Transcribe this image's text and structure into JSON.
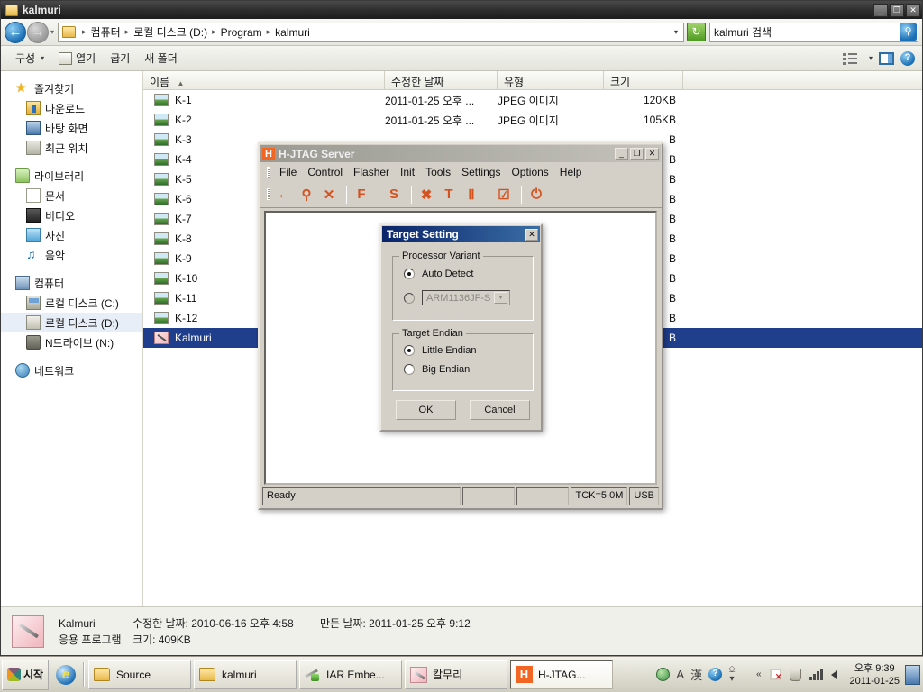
{
  "explorer": {
    "title": "kalmuri",
    "window_buttons": {
      "minimize": "_",
      "restore": "❐",
      "close": "✕"
    },
    "nav": {
      "back_icon": "←",
      "forward_icon": "→",
      "history_caret": "▾",
      "breadcrumbs": [
        "컴퓨터",
        "로컬 디스크 (D:)",
        "Program",
        "kalmuri"
      ],
      "crumb_separator": "▸",
      "address_caret": "▾",
      "refresh_icon": "↻",
      "search_value": "kalmuri 검색",
      "search_placeholder": "kalmuri 검색",
      "search_icon": "⚲"
    },
    "toolbar": {
      "organize": "구성",
      "organize_caret": "▾",
      "open": "열기",
      "burn": "굽기",
      "new_folder": "새 폴더",
      "views_caret": "▾",
      "help": "?"
    },
    "sidebar": {
      "groups": [
        {
          "header": {
            "label": "즐겨찾기",
            "icon": "star-icon"
          },
          "items": [
            {
              "label": "다운로드",
              "icon": "downloads-icon"
            },
            {
              "label": "바탕 화면",
              "icon": "desktop-icon"
            },
            {
              "label": "최근 위치",
              "icon": "recent-places-icon"
            }
          ]
        },
        {
          "header": {
            "label": "라이브러리",
            "icon": "library-icon"
          },
          "items": [
            {
              "label": "문서",
              "icon": "documents-icon"
            },
            {
              "label": "비디오",
              "icon": "videos-icon"
            },
            {
              "label": "사진",
              "icon": "pictures-icon"
            },
            {
              "label": "음악",
              "icon": "music-icon"
            }
          ]
        },
        {
          "header": {
            "label": "컴퓨터",
            "icon": "computer-icon"
          },
          "items": [
            {
              "label": "로컬 디스크 (C:)",
              "icon": "local-disk-c-icon"
            },
            {
              "label": "로컬 디스크 (D:)",
              "icon": "local-disk-d-icon",
              "selected": true
            },
            {
              "label": "N드라이브 (N:)",
              "icon": "network-drive-icon"
            }
          ]
        },
        {
          "header": {
            "label": "네트워크",
            "icon": "network-icon"
          },
          "items": []
        }
      ]
    },
    "filelist": {
      "columns": [
        "이름",
        "수정한 날짜",
        "유형",
        "크기"
      ],
      "sort_indicator": "▲",
      "rows": [
        {
          "name": "K-1",
          "date": "2011-01-25 오후 ...",
          "type": "JPEG 이미지",
          "size": "120KB"
        },
        {
          "name": "K-2",
          "date": "2011-01-25 오후 ...",
          "type": "JPEG 이미지",
          "size": "105KB"
        },
        {
          "name": "K-3",
          "date": "",
          "type": "",
          "size": "B"
        },
        {
          "name": "K-4",
          "date": "",
          "type": "",
          "size": "B"
        },
        {
          "name": "K-5",
          "date": "",
          "type": "",
          "size": "B"
        },
        {
          "name": "K-6",
          "date": "",
          "type": "",
          "size": "B"
        },
        {
          "name": "K-7",
          "date": "",
          "type": "",
          "size": "B"
        },
        {
          "name": "K-8",
          "date": "",
          "type": "",
          "size": "B"
        },
        {
          "name": "K-9",
          "date": "",
          "type": "",
          "size": "B"
        },
        {
          "name": "K-10",
          "date": "",
          "type": "",
          "size": "B"
        },
        {
          "name": "K-11",
          "date": "",
          "type": "",
          "size": "B"
        },
        {
          "name": "K-12",
          "date": "",
          "type": "",
          "size": "B"
        },
        {
          "name": "Kalmuri",
          "date": "",
          "type": "",
          "size": "B",
          "selected": true,
          "icon": "exe-icon"
        }
      ]
    },
    "details": {
      "name": "Kalmuri",
      "kind": "응용 프로그램",
      "modified_label": "수정한 날짜: 2010-06-16 오후 4:58",
      "size_label": "크기: 409KB",
      "created_label": "만든 날짜: 2011-01-25 오후 9:12"
    }
  },
  "hjtag": {
    "title": "H-JTAG Server",
    "icon_letter": "H",
    "window_buttons": {
      "minimize": "_",
      "maximize": "❐",
      "close": "✕"
    },
    "menus": [
      "File",
      "Control",
      "Flasher",
      "Init",
      "Tools",
      "Settings",
      "Options",
      "Help"
    ],
    "toolbar_icons": [
      {
        "name": "detect-target-icon",
        "glyph": "←"
      },
      {
        "name": "search-icon",
        "glyph": "⚲"
      },
      {
        "name": "close-target-icon",
        "glyph": "✕"
      },
      {
        "name": "flasher-icon",
        "glyph": "F"
      },
      {
        "name": "settings-icon",
        "glyph": "S"
      },
      {
        "name": "jtag-config-icon",
        "glyph": "✖"
      },
      {
        "name": "tap-config-icon",
        "glyph": "T"
      },
      {
        "name": "pillar-config-icon",
        "glyph": "Ⅱ"
      },
      {
        "name": "checklist-icon",
        "glyph": "☑"
      },
      {
        "name": "power-icon",
        "glyph": "⏻"
      }
    ],
    "status": {
      "message": "Ready",
      "cell1": "",
      "cell2": "",
      "tck": "TCK=5,0M",
      "iface": "USB"
    }
  },
  "dialog": {
    "title": "Target Setting",
    "close_button": "✕",
    "processor_variant": {
      "legend": "Processor Variant",
      "auto_detect_label": "Auto  Detect",
      "auto_detect_selected": true,
      "manual_selected": false,
      "variant_value": "ARM1136JF-S",
      "dropdown_arrow": "▼",
      "disabled": true
    },
    "target_endian": {
      "legend": "Target Endian",
      "options": [
        {
          "label": "Little  Endian",
          "selected": true
        },
        {
          "label": "Big   Endian",
          "selected": false
        }
      ]
    },
    "ok_button": "OK",
    "cancel_button": "Cancel"
  },
  "taskbar": {
    "start_label": "시작",
    "quicklaunch": [
      {
        "name": "internet-explorer-icon",
        "glyph": "e"
      }
    ],
    "buttons": [
      {
        "label": "Source",
        "icon": "folder-icon",
        "active": false
      },
      {
        "label": "kalmuri",
        "icon": "folder-icon",
        "active": false
      },
      {
        "label": "IAR Embe...",
        "icon": "iar-icon",
        "active": false
      },
      {
        "label": "칼무리",
        "icon": "kalmuri-icon",
        "active": false
      },
      {
        "label": "H-JTAG...",
        "icon": "hjtag-icon",
        "active": true
      }
    ],
    "ime": {
      "globe": "●",
      "latin": "A",
      "hanja": "漢",
      "help": "?",
      "keyboard": "⌨"
    },
    "tray": {
      "expand": "«",
      "icons": [
        "network-disconnected-icon",
        "security-shield-icon",
        "signal-bars-icon",
        "volume-icon"
      ]
    },
    "clock": {
      "time": "오후 9:39",
      "date": "2011-01-25"
    },
    "show_desktop": "show-desktop-button"
  },
  "colors": {
    "desktop": "#000000",
    "selection_blue": "#1f3e8c",
    "dialog_titlebar": "#0a246a",
    "hjtag_accent": "#f26522",
    "classic_face": "#d4d0c8"
  }
}
